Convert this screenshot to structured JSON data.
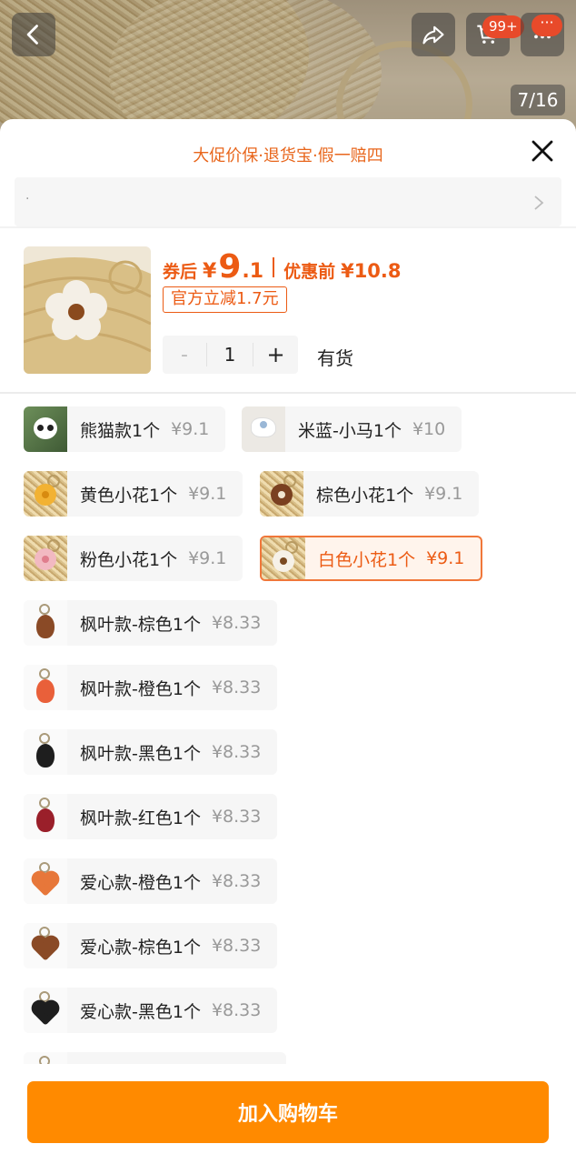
{
  "header": {
    "cart_badge": "99+",
    "more_badge": "···",
    "image_counter": "7/16"
  },
  "sheet": {
    "promo_title": "大促价保·退货宝·假一赔四",
    "address_text": "·"
  },
  "product": {
    "price_after_label": "券后",
    "price_symbol": "¥",
    "price_integer": "9",
    "price_decimal": ".1",
    "price_before_label": "优惠前",
    "price_before": "¥10.8",
    "coupon_tag": "官方立减1.7元",
    "quantity": "1",
    "qty_minus": "-",
    "qty_plus": "+",
    "stock": "有货"
  },
  "options": [
    {
      "label": "熊猫款1个",
      "price": "¥9.1",
      "thumb": "panda"
    },
    {
      "label": "米蓝-小马1个",
      "price": "¥10",
      "thumb": "horse"
    },
    {
      "label": "黄色小花1个",
      "price": "¥9.1",
      "thumb": "flower-yellow"
    },
    {
      "label": "棕色小花1个",
      "price": "¥9.1",
      "thumb": "flower-brown"
    },
    {
      "label": "粉色小花1个",
      "price": "¥9.1",
      "thumb": "flower-pink"
    },
    {
      "label": "白色小花1个",
      "price": "¥9.1",
      "thumb": "flower-white",
      "selected": true
    },
    {
      "label": "枫叶款-棕色1个",
      "price": "¥8.33",
      "thumb": "leaf-brown"
    },
    {
      "label": "枫叶款-橙色1个",
      "price": "¥8.33",
      "thumb": "leaf-orange"
    },
    {
      "label": "枫叶款-黑色1个",
      "price": "¥8.33",
      "thumb": "leaf-black"
    },
    {
      "label": "枫叶款-红色1个",
      "price": "¥8.33",
      "thumb": "leaf-red"
    },
    {
      "label": "爱心款-橙色1个",
      "price": "¥8.33",
      "thumb": "heart-orange"
    },
    {
      "label": "爱心款-棕色1个",
      "price": "¥8.33",
      "thumb": "heart-brown"
    },
    {
      "label": "爱心款-黑色1个",
      "price": "¥8.33",
      "thumb": "heart-black"
    }
  ],
  "footer": {
    "add_to_cart": "加入购物车"
  },
  "colors": {
    "accent": "#ec5b14",
    "button": "#ff8a00",
    "selected_bg": "#fff4ec"
  }
}
